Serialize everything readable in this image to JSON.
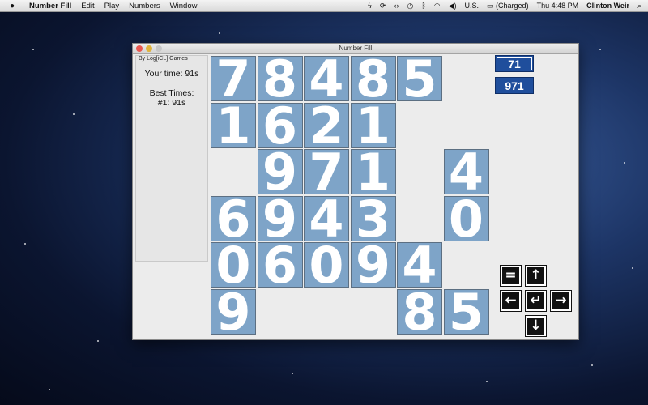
{
  "menubar": {
    "apple": "",
    "app": "Number Fill",
    "items": [
      "Edit",
      "Play",
      "Numbers",
      "Window"
    ],
    "status": {
      "input": "U.S.",
      "battery": "(Charged)",
      "clock": "Thu 4:48 PM",
      "user": "Clinton Weir"
    }
  },
  "window": {
    "title": "Number Fill",
    "credit": "By Log[iCL] Games",
    "your_time": "Your time: 91s",
    "best_times_header": "Best Times:",
    "best_times": [
      "#1: 91s"
    ]
  },
  "targets": [
    "71",
    "971"
  ],
  "board": {
    "rows": [
      [
        "7",
        "8",
        "4",
        "8",
        "5",
        "",
        ""
      ],
      [
        "1",
        "6",
        "2",
        "1",
        "",
        "",
        ""
      ],
      [
        "",
        "9",
        "7",
        "1",
        "",
        "4",
        ""
      ],
      [
        "6",
        "9",
        "4",
        "3",
        "",
        "0",
        ""
      ],
      [
        "0",
        "6",
        "0",
        "9",
        "4",
        "",
        ""
      ],
      [
        "9",
        "",
        "",
        "",
        "8",
        "5",
        ""
      ]
    ]
  },
  "controls": {
    "equals": "=",
    "up": "↑",
    "left": "←",
    "enter": "↵",
    "right": "→",
    "down": "↓"
  }
}
